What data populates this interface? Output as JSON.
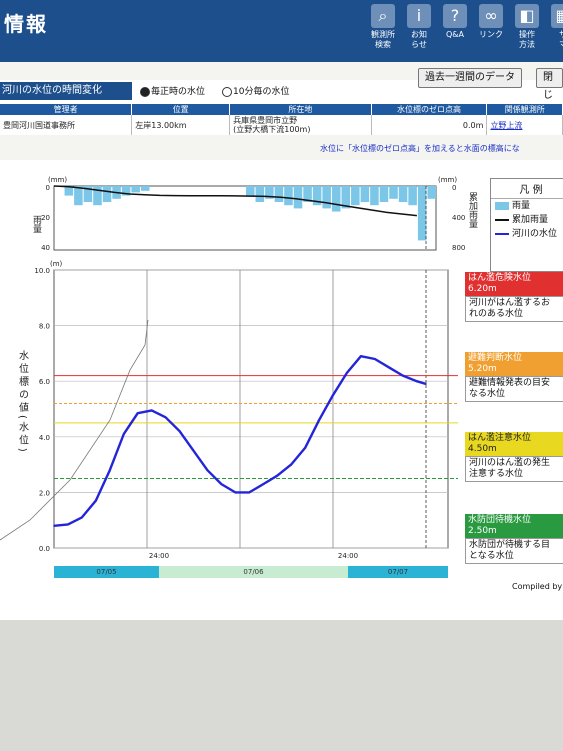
{
  "app_title": "情報",
  "nav": [
    {
      "label": "観測所\n検索",
      "icon": "search-icon"
    },
    {
      "label": "お知\nらせ",
      "icon": "info-icon"
    },
    {
      "label": "Q&A",
      "icon": "help-icon"
    },
    {
      "label": "リンク",
      "icon": "link-icon"
    },
    {
      "label": "操作\n方法",
      "icon": "mouse-icon"
    },
    {
      "label": "サ\nマ",
      "icon": "sitemap-icon"
    }
  ],
  "section_title": "河川の水位の時間変化",
  "radio": {
    "option1": "毎正時の水位",
    "option2": "10分毎の水位"
  },
  "buttons": {
    "past_week": "過去一週間のデータ",
    "close": "閉じ"
  },
  "info_table": {
    "headers": [
      "管理者",
      "位置",
      "所在地",
      "水位標のゼロ点高",
      "関係観測所"
    ],
    "row": [
      "豊岡河川国道事務所",
      "左岸13.00km",
      "兵庫県豊岡市立野\n(立野大橋下流100m)",
      "0.0m",
      "立野上流"
    ]
  },
  "note": "水位に「水位標のゼロ点高」を加えると水面の標高にな",
  "rain_chart": {
    "left_unit": "(mm)",
    "right_unit": "(mm)",
    "left_label": "雨量",
    "right_label": "累加雨量",
    "left_ticks": [
      "0",
      "20",
      "40"
    ],
    "right_ticks": [
      "0",
      "400",
      "800"
    ]
  },
  "legend": {
    "title": "凡 例",
    "items": [
      {
        "label": "雨量",
        "color": "#7cc7e8"
      },
      {
        "label": "累加雨量",
        "color": "#111111"
      },
      {
        "label": "河川の水位",
        "color": "#2424d8"
      }
    ]
  },
  "chart_data": {
    "type": "line",
    "ylabel": "水位標の値(水位)",
    "yunit": "(m)",
    "ylim": [
      0,
      10
    ],
    "yticks": [
      "0.0",
      "2.0",
      "4.0",
      "6.0",
      "8.0",
      "10.0"
    ],
    "xtick_labels": [
      "24:00",
      "24:00"
    ],
    "date_labels": [
      "07/05",
      "07/06",
      "07/07"
    ],
    "series": [
      {
        "name": "河川の水位",
        "color": "#2424d8",
        "x": [
          0,
          3,
          6,
          9,
          12,
          15,
          18,
          21,
          24,
          27,
          30,
          33,
          36,
          39,
          42,
          45,
          48,
          51,
          54,
          57,
          60,
          63,
          66,
          69,
          72,
          75,
          78,
          80
        ],
        "values": [
          0.8,
          0.85,
          1.1,
          1.7,
          2.8,
          4.1,
          4.85,
          4.95,
          4.7,
          4.2,
          3.5,
          2.8,
          2.3,
          2.0,
          2.0,
          2.3,
          2.6,
          3.0,
          3.6,
          4.6,
          5.5,
          6.3,
          6.9,
          6.8,
          6.5,
          6.2,
          6.0,
          5.9
        ]
      }
    ],
    "thresholds": [
      {
        "name": "はん濫危険水位",
        "value": 6.2,
        "value_label": "6.20m",
        "desc": "河川がはん濫するお\nれのある水位",
        "color": "#e03030"
      },
      {
        "name": "避難判断水位",
        "value": 5.2,
        "value_label": "5.20m",
        "desc": "避難情報発表の目安\nなる水位",
        "color": "#f0a030"
      },
      {
        "name": "はん濫注意水位",
        "value": 4.5,
        "value_label": "4.50m",
        "desc": "河川のはん濫の発生\n注意する水位",
        "color": "#e8d820"
      },
      {
        "name": "水防団待機水位",
        "value": 2.5,
        "value_label": "2.50m",
        "desc": "水防団が待機する目\nとなる水位",
        "color": "#2a9a40"
      }
    ],
    "rain": [
      0,
      6,
      12,
      10,
      12,
      10,
      8,
      6,
      4,
      3,
      0,
      0,
      0,
      0,
      0,
      0,
      0,
      0,
      0,
      0,
      6,
      10,
      8,
      10,
      12,
      14,
      10,
      12,
      14,
      16,
      14,
      12,
      10,
      12,
      10,
      8,
      10,
      12,
      34,
      8
    ],
    "cumulative": [
      0,
      10,
      30,
      55,
      80,
      100,
      110,
      118,
      120,
      122,
      122,
      122,
      124,
      126,
      130,
      140,
      160,
      185,
      210,
      240,
      270,
      300,
      330,
      350,
      370
    ]
  },
  "compiled": "Compiled by"
}
